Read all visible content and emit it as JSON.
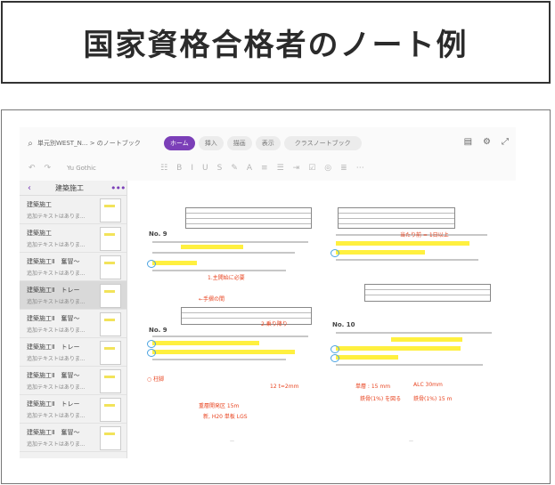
{
  "header": {
    "title": "国家資格合格者のノート例"
  },
  "app": {
    "notebook_path": "単元別WEST_N... > のノートブック",
    "tabs": [
      "ホーム",
      "挿入",
      "描画",
      "表示",
      "クラスノートブック"
    ],
    "active_tab": "ホーム",
    "icons_right": [
      "notebook-icon",
      "settings-icon",
      "expand-icon"
    ],
    "toolbar": {
      "font": "Yu Gothic"
    },
    "sidebar": {
      "title": "建築施工",
      "sections": [
        {
          "name": "建築施工",
          "sub": "追加テキストはありま..."
        },
        {
          "name": "建築施工",
          "sub": "追加テキストはありま..."
        },
        {
          "name": "建築施工Ⅱ　奮冒～",
          "sub": "追加テキストはありま..."
        },
        {
          "name": "建築施工Ⅱ　トレー",
          "sub": "追加テキストはありま..."
        },
        {
          "name": "建築施工Ⅱ　奮冒～",
          "sub": "追加テキストはありま..."
        },
        {
          "name": "建築施工Ⅱ　トレー",
          "sub": "追加テキストはありま..."
        },
        {
          "name": "建築施工Ⅱ　奮冒～",
          "sub": "追加テキストはありま..."
        },
        {
          "name": "建築施工Ⅱ　トレー",
          "sub": "追加テキストはありま..."
        },
        {
          "name": "建築施工Ⅱ　奮冒～",
          "sub": "追加テキストはありま..."
        },
        {
          "name": "建築施工Ⅱ　トレー",
          "sub": "追加テキストはありま..."
        }
      ],
      "selected_index": 3
    },
    "page_left": {
      "q1": "No. 9",
      "q2": "No. 9",
      "notes": [
        "←手摺の間",
        "1.主開始に必要",
        "2.乗り降り",
        "○ 柱脚",
        "12 t=2mm",
        "重層開発区 15m",
        "新, H20 単板 LGS"
      ]
    },
    "page_right": {
      "q1": "No. 10",
      "notes": [
        "当たり前 = 1日以上",
        "単層 : 15 mm",
        "鉄骨(1%) を図る",
        "鉄骨(1%) 15 m",
        "ALC 30mm"
      ]
    }
  }
}
